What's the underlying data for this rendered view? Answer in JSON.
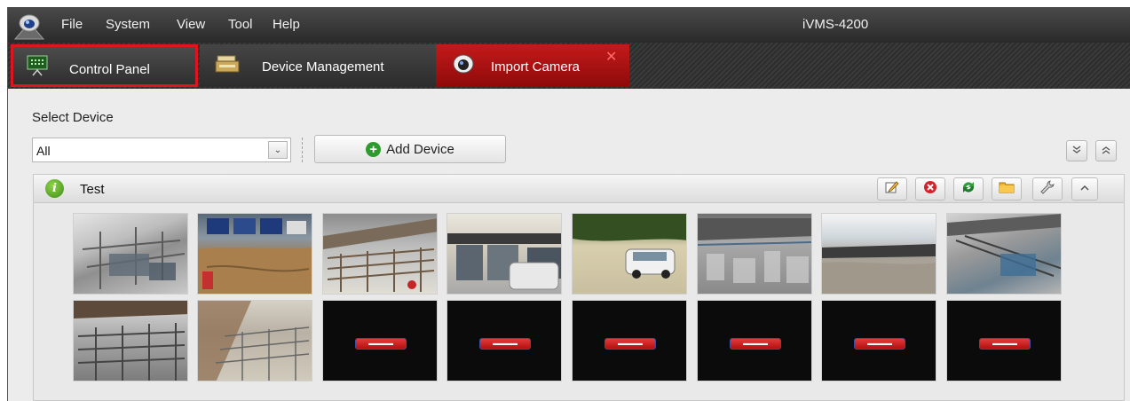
{
  "app": {
    "title": "iVMS-4200",
    "menu": [
      "File",
      "System",
      "View",
      "Tool",
      "Help"
    ]
  },
  "tabs": [
    {
      "label": "Control Panel",
      "highlighted": true
    },
    {
      "label": "Device Management"
    },
    {
      "label": "Import Camera",
      "active": true
    }
  ],
  "device_bar": {
    "select_label": "Select Device",
    "dropdown_value": "All",
    "add_button": "Add Device"
  },
  "device": {
    "name": "Test",
    "toolbar_icons": [
      "edit-icon",
      "delete-icon",
      "refresh-icon",
      "folder-icon",
      "wrench-icon",
      "collapse-icon"
    ]
  },
  "cameras": [
    {
      "kind": "live",
      "scene": "barn-interior"
    },
    {
      "kind": "live",
      "scene": "office-floor"
    },
    {
      "kind": "live",
      "scene": "barn-gate"
    },
    {
      "kind": "live",
      "scene": "building-entrance"
    },
    {
      "kind": "live",
      "scene": "parking-car"
    },
    {
      "kind": "live",
      "scene": "shed-outdoor"
    },
    {
      "kind": "live",
      "scene": "field"
    },
    {
      "kind": "live",
      "scene": "barn-feeders"
    },
    {
      "kind": "live",
      "scene": "stalls"
    },
    {
      "kind": "live",
      "scene": "barn-interior-2"
    },
    {
      "kind": "placeholder"
    },
    {
      "kind": "placeholder"
    },
    {
      "kind": "placeholder"
    },
    {
      "kind": "placeholder"
    },
    {
      "kind": "placeholder"
    },
    {
      "kind": "placeholder"
    }
  ],
  "colors": {
    "accent_red": "#c41a1a",
    "highlight_border": "#e0141e",
    "menubar": "#333333"
  }
}
